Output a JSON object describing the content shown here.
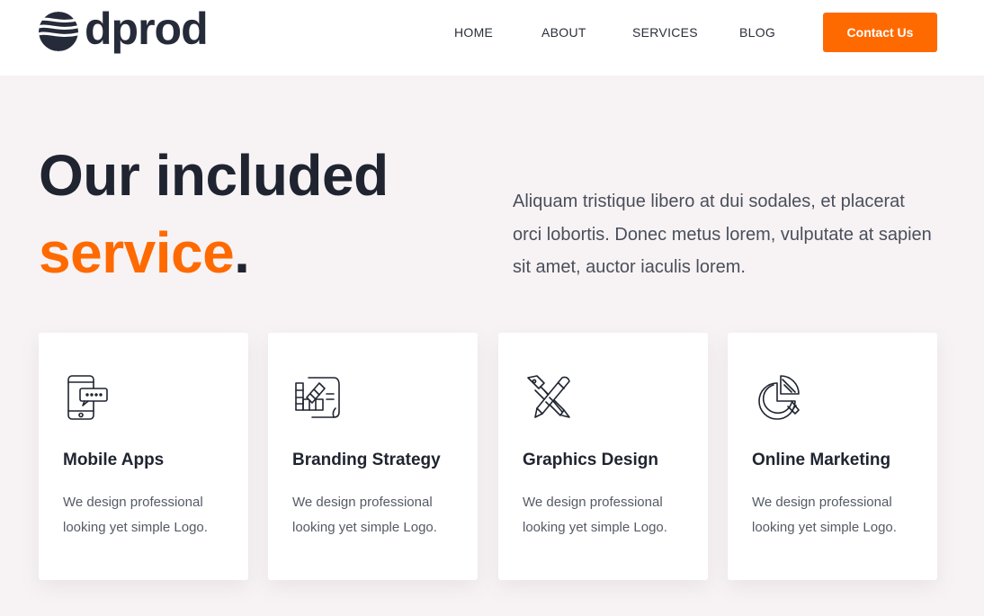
{
  "brand": {
    "name": "dprod",
    "accent_color": "#ff6a00",
    "text_color": "#1f2430"
  },
  "nav": {
    "items": [
      {
        "label": "HOME"
      },
      {
        "label": "ABOUT"
      },
      {
        "label": "SERVICES"
      },
      {
        "label": "BLOG"
      }
    ],
    "cta_label": "Contact Us"
  },
  "hero": {
    "title_line1": "Our included",
    "title_accent": "service",
    "title_end": ".",
    "description": "Aliquam tristique libero at dui sodales, et placerat orci lobortis. Donec metus lorem, vulputate at sapien sit amet, auctor iaculis lorem."
  },
  "services": [
    {
      "icon": "mobile-chat-icon",
      "title": "Mobile Apps",
      "description": "We design professional looking yet simple Logo."
    },
    {
      "icon": "color-palette-icon",
      "title": "Branding Strategy",
      "description": "We design professional looking yet simple Logo."
    },
    {
      "icon": "pen-pencil-cross-icon",
      "title": "Graphics Design",
      "description": "We design professional looking yet simple Logo."
    },
    {
      "icon": "pie-chart-icon",
      "title": "Online Marketing",
      "description": "We design professional looking yet simple Logo."
    }
  ]
}
